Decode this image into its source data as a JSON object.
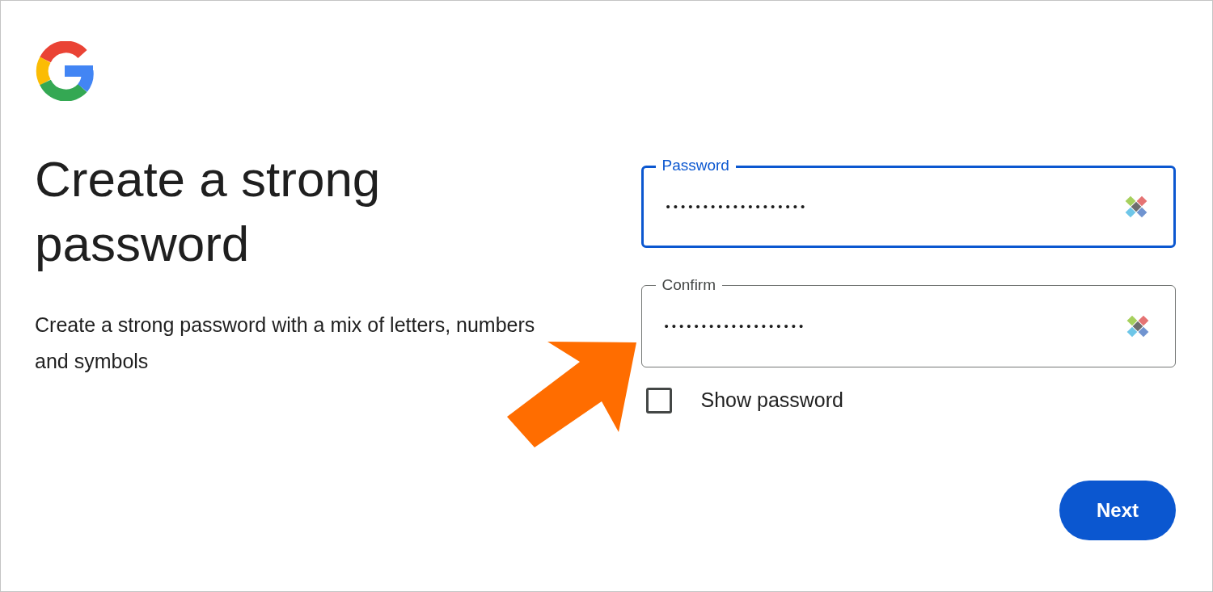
{
  "title": "Create a strong password",
  "description": "Create a strong password with a mix of letters, numbers and symbols",
  "fields": [
    {
      "label": "Password",
      "value": "•••••••••••••••••••",
      "focused": true
    },
    {
      "label": "Confirm",
      "value": "•••••••••••••••••••",
      "focused": false
    }
  ],
  "show_password": {
    "label": "Show password",
    "checked": false
  },
  "next_button": "Next"
}
